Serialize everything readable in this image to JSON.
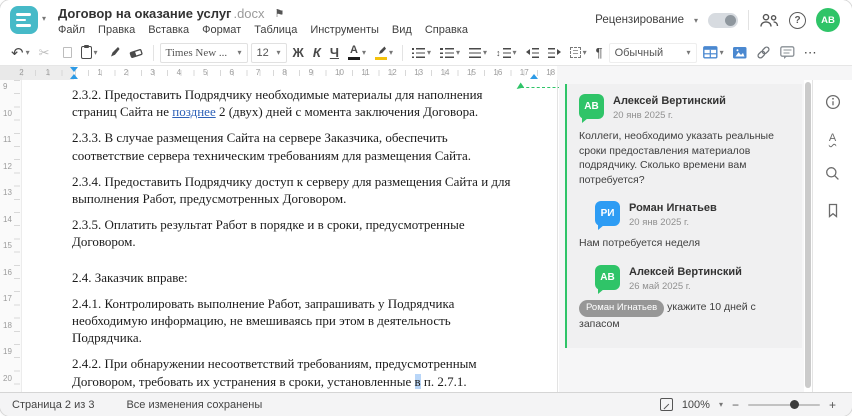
{
  "window": {
    "title": "Договор на оказание услуг",
    "ext": ".docx"
  },
  "colors": {
    "green": "#2fc468",
    "blue": "#2d9cf4",
    "teal": "#46bac8",
    "marker_blue": "#2e9be6",
    "tracked_blue": "#2f62b8",
    "toolbar_blue": "#4a88d0",
    "highlight_yellow": "#f4c20d"
  },
  "icons": {
    "caret": "▾",
    "undo": "↶",
    "cut": "✂",
    "pilcrow": "¶",
    "more": "⋯",
    "flag": "⚑",
    "help": "?",
    "minus": "−",
    "plus": "+",
    "spell_letter": "А",
    "spacing_arrow": "↕"
  },
  "header": {
    "menu": [
      "Файл",
      "Правка",
      "Вставка",
      "Формат",
      "Таблица",
      "Инструменты",
      "Вид",
      "Справка"
    ],
    "review_label": "Рецензирование",
    "avatar_initials": "АВ"
  },
  "toolbar": {
    "font_name": "Times New ...",
    "font_size": "12",
    "bold": "Ж",
    "italic": "К",
    "underline": "Ч",
    "font_color_letter": "А",
    "style_name": "Обычный"
  },
  "ruler": {
    "h_margin": [
      "1",
      "2"
    ],
    "h": [
      "1",
      "2",
      "3",
      "4",
      "5",
      "6",
      "7",
      "8",
      "9",
      "10",
      "11",
      "12",
      "13",
      "14",
      "15",
      "16",
      "17",
      "18"
    ],
    "v": [
      "9",
      "10",
      "11",
      "12",
      "13",
      "14",
      "15",
      "16",
      "17",
      "18",
      "19",
      "20"
    ]
  },
  "document": {
    "p1": {
      "before": "2.3.2. Предоставить Подрядчику необходимые материалы для наполнения страниц Сайта не ",
      "insert": "позднее",
      "after": " 2 (двух) дней с момента заключения Договора."
    },
    "p2": "2.3.3. В случае размещения Сайта на сервере Заказчика, обеспечить соответствие сервера техническим требованиям для размещения Сайта.",
    "p3": "2.3.4. Предоставить Подрядчику доступ к серверу для размещения Сайта и для выполнения Работ, предусмотренных Договором.",
    "p4": "2.3.5. Оплатить результат Работ в порядке и в сроки, предусмотренные Договором.",
    "p5": "2.4. Заказчик вправе:",
    "p6": "2.4.1. Контролировать выполнение Работ, запрашивать у Подрядчика необходимую информацию, не вмешиваясь при этом в деятельность Подрядчика.",
    "p7": {
      "before": "2.4.2. При обнаружении несоответствий требованиям, предусмотренным Договором, требовать их устранения в сроки, установленные ",
      "highlight": "в",
      "after": " п. 2.7.1."
    }
  },
  "comments": {
    "thread": [
      {
        "initials": "АВ",
        "name": "Алексей Вертинский",
        "date": "20 янв 2025 г.",
        "color": "green",
        "reply": false,
        "text": "Коллеги, необходимо указать реальные сроки предоставления материалов подрядчику. Сколько времени вам потребуется?"
      },
      {
        "initials": "РИ",
        "name": "Роман Игнатьев",
        "date": "20 янв 2025 г.",
        "color": "blue",
        "reply": true,
        "text": "Нам потребуется неделя"
      },
      {
        "initials": "АВ",
        "name": "Алексей Вертинский",
        "date": "26 май 2025 г.",
        "color": "green",
        "reply": true,
        "mention": "Роман Игнатьев",
        "text": "укажите 10 дней с запасом"
      }
    ]
  },
  "statusbar": {
    "page": "Страница 2 из 3",
    "saved": "Все изменения сохранены",
    "zoom": "100%"
  }
}
